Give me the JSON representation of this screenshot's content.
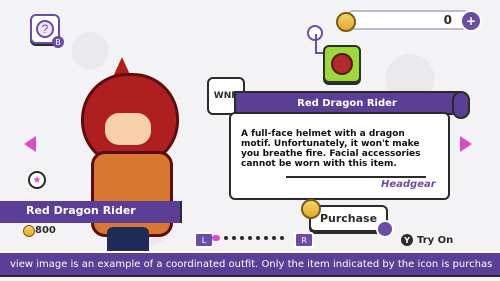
{
  "top_bar": {
    "coins_value": "0"
  },
  "item": {
    "name": "Red Dragon Rider",
    "category": "Headgear",
    "description": "A full-face helmet with a dragon motif. Unfortunately, it won't make you breathe fire. Facial accessories cannot be worn with this item.",
    "brand_code": "WNR",
    "price": "800"
  },
  "actions": {
    "purchase_label": "Purchase",
    "try_on_label": "Try On",
    "l_label": "L",
    "r_label": "R",
    "try_on_button_label": "Y"
  },
  "footer": {
    "text": "view image is an example of a coordinated outfit. Only the item indicated by the icon is purchas"
  },
  "colors": {
    "accent_purple": "#5b3f96",
    "accent_pink": "#d94bd2",
    "accent_green": "#9bdb39",
    "coin_yellow": "#f7d46a"
  },
  "icons": {
    "help_icon": "question-bubble",
    "brand_icon": "shield-logo",
    "item_icon": "red-helmet",
    "star_icon": "star",
    "coin_icon": "coin",
    "plus_icon": "plus",
    "left_arrow_icon": "triangle-left",
    "right_arrow_icon": "triangle-right"
  }
}
